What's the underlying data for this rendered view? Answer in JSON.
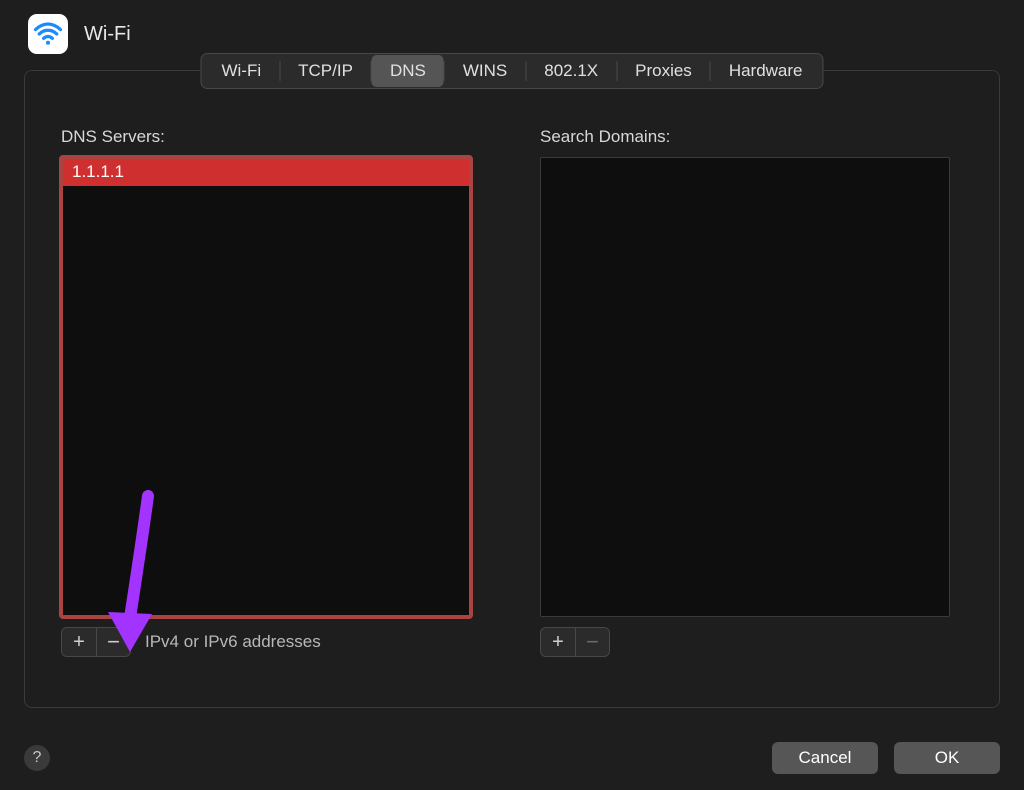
{
  "header": {
    "title": "Wi-Fi"
  },
  "tabs": {
    "items": [
      "Wi-Fi",
      "TCP/IP",
      "DNS",
      "WINS",
      "802.1X",
      "Proxies",
      "Hardware"
    ],
    "active_index": 2
  },
  "panels": {
    "dns_servers": {
      "label": "DNS Servers:",
      "entries": [
        "1.1.1.1"
      ],
      "hint": "IPv4 or IPv6 addresses"
    },
    "search_domains": {
      "label": "Search Domains:",
      "entries": []
    }
  },
  "buttons": {
    "cancel": "Cancel",
    "ok": "OK",
    "help": "?"
  },
  "icons": {
    "plus": "+",
    "minus": "−"
  },
  "annotation": {
    "arrow_color": "#a333ff"
  }
}
